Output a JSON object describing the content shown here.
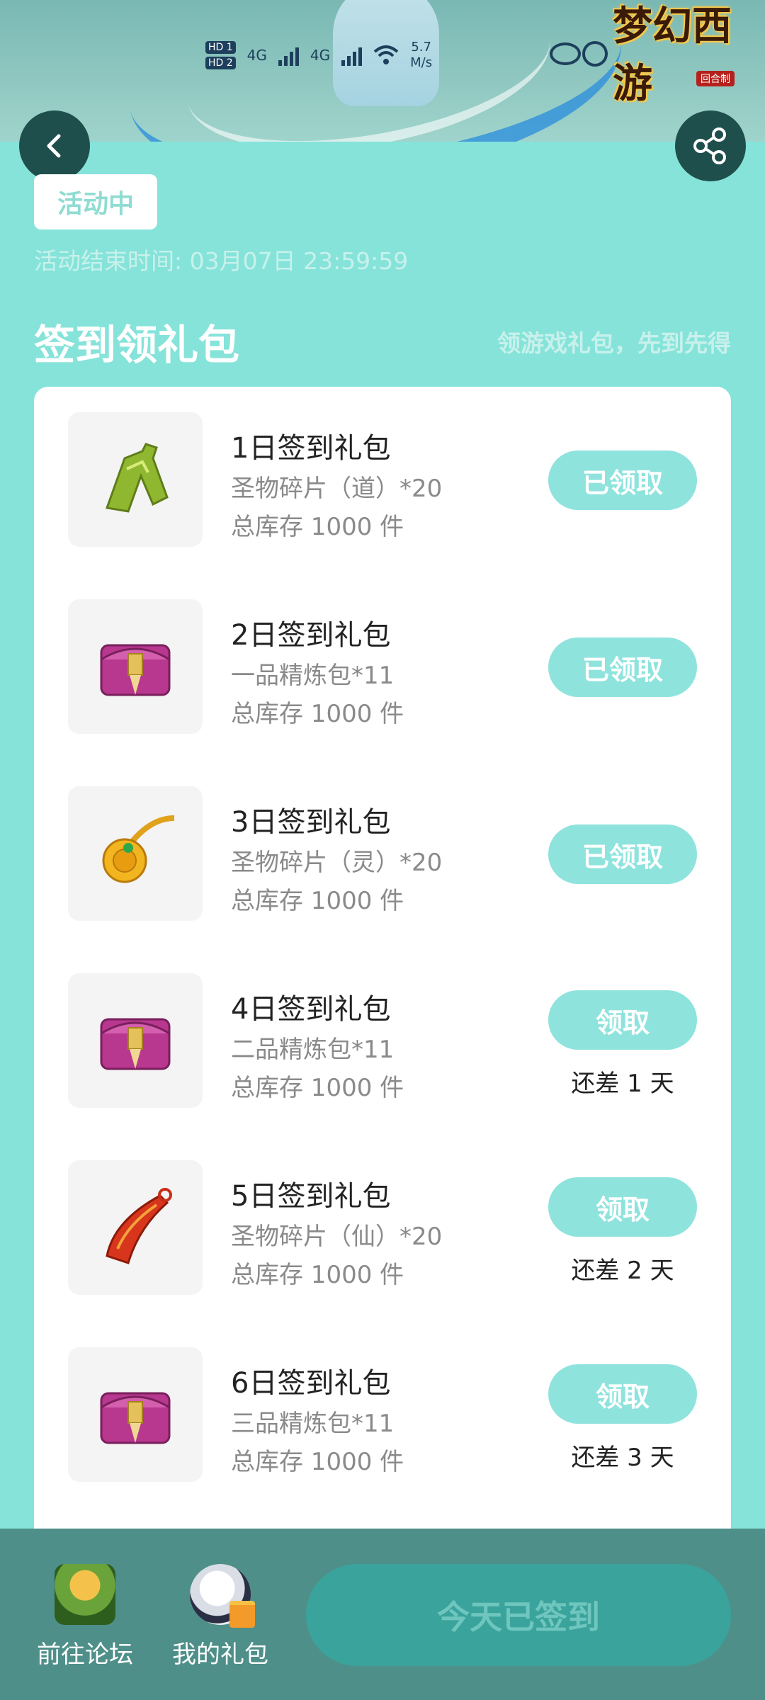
{
  "status_bar": {
    "hd1": "HD 1",
    "hd2": "HD 2",
    "net1": "4G",
    "net2": "4G",
    "speed_value": "5.7",
    "speed_unit": "M/s"
  },
  "header": {
    "game_logo_text": "梦幻西游",
    "game_logo_sub": "回合制"
  },
  "activity": {
    "status_badge": "活动中",
    "end_time": "活动结束时间: 03月07日 23:59:59"
  },
  "section": {
    "title": "签到领礼包",
    "subtitle": "领游戏礼包，先到先得"
  },
  "gifts": [
    {
      "title": "1日签到礼包",
      "item": "圣物碎片（道）*20",
      "stock": "总库存 1000 件",
      "button": "已领取",
      "remain": "",
      "icon": "jade-token-icon"
    },
    {
      "title": "2日签到礼包",
      "item": "一品精炼包*11",
      "stock": "总库存 1000 件",
      "button": "已领取",
      "remain": "",
      "icon": "treasure-chest-icon"
    },
    {
      "title": "3日签到礼包",
      "item": "圣物碎片（灵）*20",
      "stock": "总库存 1000 件",
      "button": "已领取",
      "remain": "",
      "icon": "gold-amulet-icon"
    },
    {
      "title": "4日签到礼包",
      "item": "二品精炼包*11",
      "stock": "总库存 1000 件",
      "button": "领取",
      "remain": "还差 1 天",
      "icon": "treasure-chest-icon"
    },
    {
      "title": "5日签到礼包",
      "item": "圣物碎片（仙）*20",
      "stock": "总库存 1000 件",
      "button": "领取",
      "remain": "还差 2 天",
      "icon": "red-pendant-icon"
    },
    {
      "title": "6日签到礼包",
      "item": "三品精炼包*11",
      "stock": "总库存 1000 件",
      "button": "领取",
      "remain": "还差 3 天",
      "icon": "treasure-chest-icon"
    }
  ],
  "bottom_bar": {
    "forum_label": "前往论坛",
    "gifts_label": "我的礼包",
    "checkin_label": "今天已签到"
  },
  "colors": {
    "background": "#86e3d9",
    "button": "#8fe3dd",
    "bottom_bar": "#4f8f89",
    "checkin_button": "#3aa39c"
  }
}
